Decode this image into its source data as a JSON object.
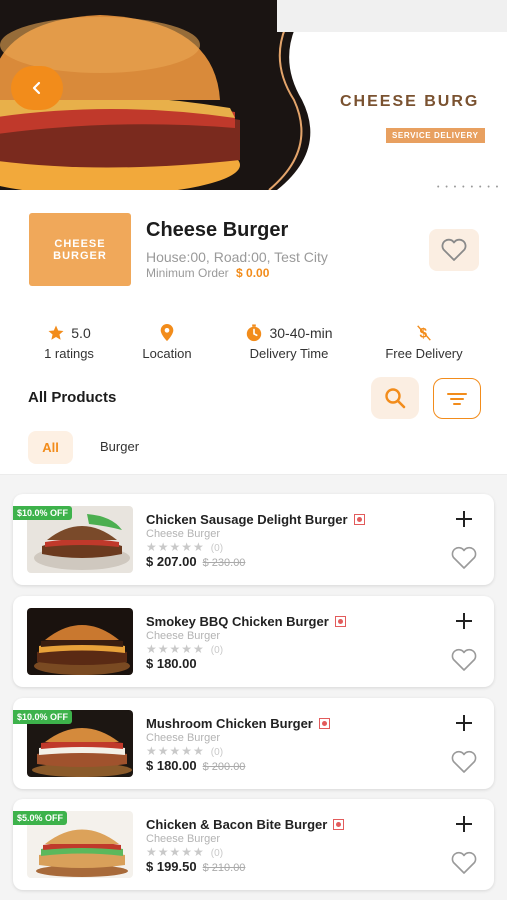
{
  "hero": {
    "title": "CHEESE BURG",
    "tag": "SERVICE DELIVERY"
  },
  "restaurant": {
    "logo_line1": "CHEESE",
    "logo_line2": "BURGER",
    "name": "Cheese Burger",
    "address": "House:00, Road:00, Test City",
    "min_order_label": "Minimum Order",
    "min_order_value": "$ 0.00"
  },
  "info": {
    "rating_value": "5.0",
    "rating_label": "1 ratings",
    "location_label": "Location",
    "delivery_time_value": "30-40-min",
    "delivery_time_label": "Delivery Time",
    "free_delivery_label": "Free Delivery"
  },
  "products_header": {
    "title": "All Products"
  },
  "tabs": [
    {
      "label": "All",
      "active": true
    },
    {
      "label": "Burger",
      "active": false
    }
  ],
  "products": [
    {
      "name": "Chicken Sausage Delight Burger",
      "category": "Cheese Burger",
      "rating_count": "(0)",
      "price": "$ 207.00",
      "old_price": "$ 230.00",
      "discount": "$10.0% OFF"
    },
    {
      "name": "Smokey BBQ Chicken Burger",
      "category": "Cheese Burger",
      "rating_count": "(0)",
      "price": "$ 180.00",
      "old_price": "",
      "discount": ""
    },
    {
      "name": "Mushroom Chicken Burger",
      "category": "Cheese Burger",
      "rating_count": "(0)",
      "price": "$ 180.00",
      "old_price": "$ 200.00",
      "discount": "$10.0% OFF"
    },
    {
      "name": "Chicken & Bacon Bite Burger",
      "category": "Cheese Burger",
      "rating_count": "(0)",
      "price": "$ 199.50",
      "old_price": "$ 210.00",
      "discount": "$5.0% OFF"
    }
  ],
  "colors": {
    "accent": "#f28c1b",
    "accent_light": "#fbeee2",
    "discount_badge": "#3db24b",
    "veg_mark": "#e25b5b"
  }
}
